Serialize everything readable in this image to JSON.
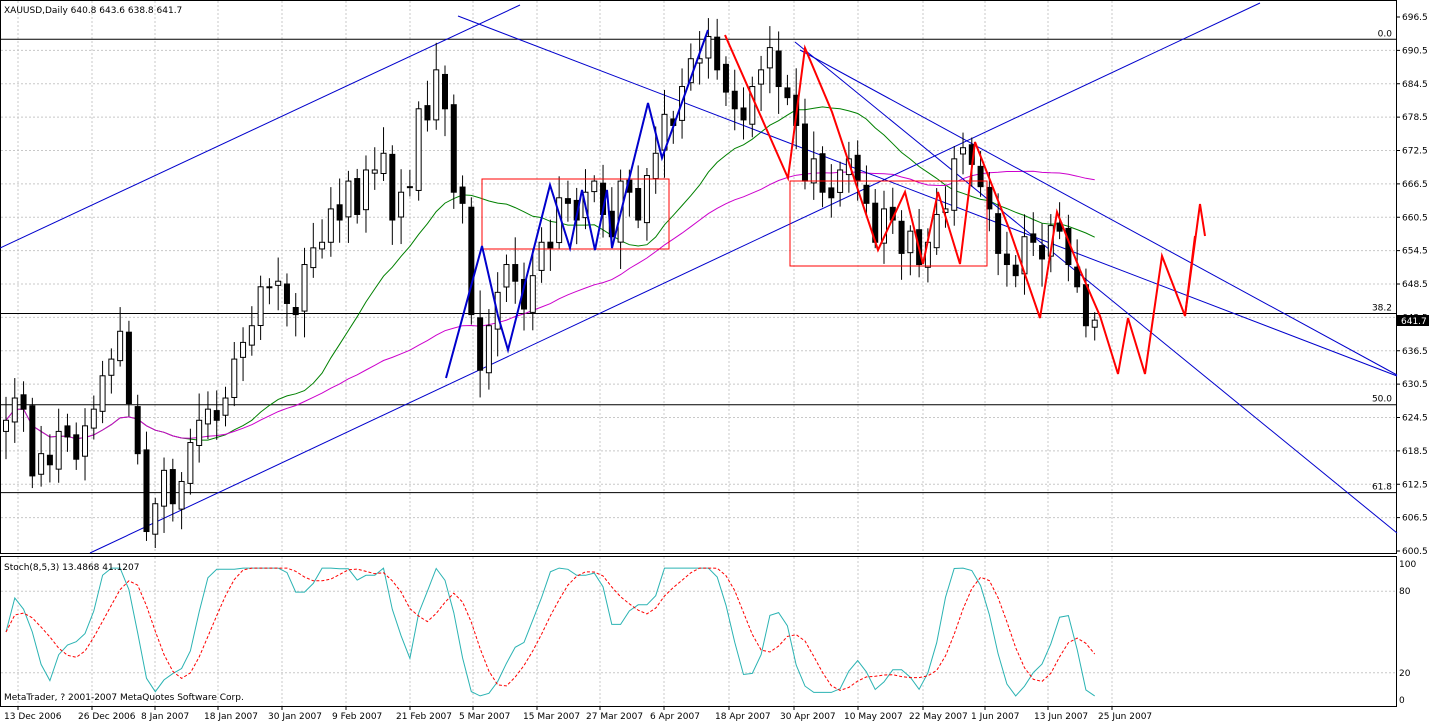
{
  "window": {
    "main_header": "XAUUSD,Daily 640.8 643.6 638.8 641.7",
    "copyright": "MetaTrader, ? 2001-2007 MetaQuotes Software Corp."
  },
  "colors": {
    "bull_candle": "#ffffff",
    "bear_candle": "#000000",
    "blue_lines": "#0000cc",
    "red_lines": "#ff0000",
    "ma_green": "#008000",
    "ma_magenta": "#cc00cc",
    "stoch_main": "#2bb3b3",
    "stoch_signal": "#ff0000",
    "grid": "#c8c8c8"
  },
  "chart_data": [
    {
      "type": "candlestick",
      "symbol": "XAUUSD",
      "timeframe": "Daily",
      "last_price": "641.7",
      "y_axis_labels": [
        "696.5",
        "690.5",
        "684.5",
        "678.5",
        "672.5",
        "666.5",
        "660.5",
        "654.5",
        "648.5",
        "642.5",
        "636.5",
        "630.5",
        "624.5",
        "618.5",
        "612.5",
        "606.5",
        "600.5"
      ],
      "ylim": [
        600.5,
        696.5
      ],
      "x_axis_labels": [
        "13 Dec 2006",
        "26 Dec 2006",
        "8 Jan 2007",
        "18 Jan 2007",
        "30 Jan 2007",
        "9 Feb 2007",
        "21 Feb 2007",
        "5 Mar 2007",
        "15 Mar 2007",
        "27 Mar 2007",
        "6 Apr 2007",
        "18 Apr 2007",
        "30 Apr 2007",
        "10 May 2007",
        "22 May 2007",
        "1 Jun 2007",
        "13 Jun 2007",
        "25 Jun 2007"
      ],
      "fib_levels": [
        {
          "label": "0.0",
          "price": 692.5
        },
        {
          "label": "38.2",
          "price": 643.2
        },
        {
          "label": "50.0",
          "price": 626.8
        },
        {
          "label": "61.8",
          "price": 611.0
        }
      ],
      "closes": [
        624,
        628,
        626,
        614,
        618,
        616,
        622,
        621,
        617,
        623,
        626,
        632,
        635,
        640,
        627,
        618,
        604,
        609,
        615,
        609,
        613,
        620,
        624,
        626,
        624,
        628,
        635,
        638,
        641,
        648,
        648,
        649,
        645,
        643,
        652,
        655,
        656,
        662,
        660,
        667,
        661,
        669,
        669,
        672,
        660,
        665,
        666,
        680,
        678,
        687,
        680,
        665,
        663,
        643,
        633,
        641,
        647,
        652,
        649,
        644,
        650,
        656,
        655,
        664,
        663,
        660,
        665,
        667,
        661,
        657,
        667,
        665,
        660,
        668,
        672,
        679,
        677,
        684,
        689,
        689,
        693,
        687,
        683,
        680,
        678,
        684,
        687,
        691,
        684,
        682,
        677,
        667,
        671,
        665,
        664,
        669,
        671,
        667,
        663,
        656,
        662,
        660,
        654,
        658,
        652,
        656,
        661,
        662,
        671,
        673,
        670,
        666,
        662,
        654,
        652,
        650,
        657,
        656,
        653,
        659,
        658,
        652,
        648,
        641,
        642
      ]
    },
    {
      "type": "line",
      "indicator": "Stoch(8,5,3)",
      "header": "Stoch(8,5,3) 13.4868 41.1207",
      "main_value": "13.4868",
      "signal_value": "41.1207",
      "y_axis_labels": [
        "100",
        "80",
        "20",
        "0"
      ],
      "ylim": [
        0,
        100
      ]
    }
  ]
}
